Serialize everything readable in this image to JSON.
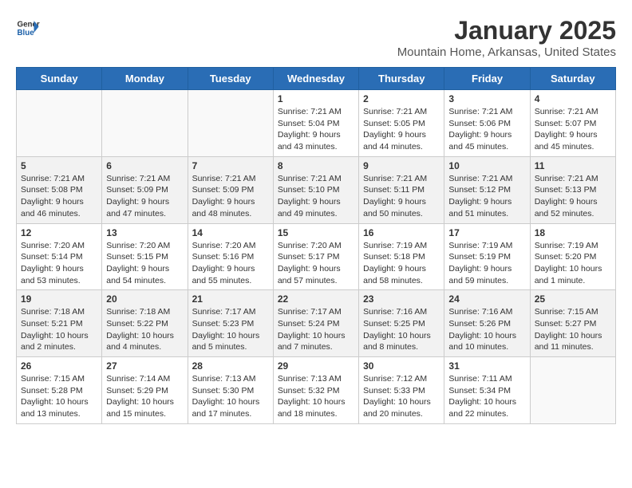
{
  "header": {
    "logo_general": "General",
    "logo_blue": "Blue",
    "title": "January 2025",
    "subtitle": "Mountain Home, Arkansas, United States"
  },
  "days_of_week": [
    "Sunday",
    "Monday",
    "Tuesday",
    "Wednesday",
    "Thursday",
    "Friday",
    "Saturday"
  ],
  "weeks": [
    {
      "bg": "white",
      "days": [
        {
          "date": "",
          "content": ""
        },
        {
          "date": "",
          "content": ""
        },
        {
          "date": "",
          "content": ""
        },
        {
          "date": "1",
          "content": "Sunrise: 7:21 AM\nSunset: 5:04 PM\nDaylight: 9 hours and 43 minutes."
        },
        {
          "date": "2",
          "content": "Sunrise: 7:21 AM\nSunset: 5:05 PM\nDaylight: 9 hours and 44 minutes."
        },
        {
          "date": "3",
          "content": "Sunrise: 7:21 AM\nSunset: 5:06 PM\nDaylight: 9 hours and 45 minutes."
        },
        {
          "date": "4",
          "content": "Sunrise: 7:21 AM\nSunset: 5:07 PM\nDaylight: 9 hours and 45 minutes."
        }
      ]
    },
    {
      "bg": "light",
      "days": [
        {
          "date": "5",
          "content": "Sunrise: 7:21 AM\nSunset: 5:08 PM\nDaylight: 9 hours and 46 minutes."
        },
        {
          "date": "6",
          "content": "Sunrise: 7:21 AM\nSunset: 5:09 PM\nDaylight: 9 hours and 47 minutes."
        },
        {
          "date": "7",
          "content": "Sunrise: 7:21 AM\nSunset: 5:09 PM\nDaylight: 9 hours and 48 minutes."
        },
        {
          "date": "8",
          "content": "Sunrise: 7:21 AM\nSunset: 5:10 PM\nDaylight: 9 hours and 49 minutes."
        },
        {
          "date": "9",
          "content": "Sunrise: 7:21 AM\nSunset: 5:11 PM\nDaylight: 9 hours and 50 minutes."
        },
        {
          "date": "10",
          "content": "Sunrise: 7:21 AM\nSunset: 5:12 PM\nDaylight: 9 hours and 51 minutes."
        },
        {
          "date": "11",
          "content": "Sunrise: 7:21 AM\nSunset: 5:13 PM\nDaylight: 9 hours and 52 minutes."
        }
      ]
    },
    {
      "bg": "white",
      "days": [
        {
          "date": "12",
          "content": "Sunrise: 7:20 AM\nSunset: 5:14 PM\nDaylight: 9 hours and 53 minutes."
        },
        {
          "date": "13",
          "content": "Sunrise: 7:20 AM\nSunset: 5:15 PM\nDaylight: 9 hours and 54 minutes."
        },
        {
          "date": "14",
          "content": "Sunrise: 7:20 AM\nSunset: 5:16 PM\nDaylight: 9 hours and 55 minutes."
        },
        {
          "date": "15",
          "content": "Sunrise: 7:20 AM\nSunset: 5:17 PM\nDaylight: 9 hours and 57 minutes."
        },
        {
          "date": "16",
          "content": "Sunrise: 7:19 AM\nSunset: 5:18 PM\nDaylight: 9 hours and 58 minutes."
        },
        {
          "date": "17",
          "content": "Sunrise: 7:19 AM\nSunset: 5:19 PM\nDaylight: 9 hours and 59 minutes."
        },
        {
          "date": "18",
          "content": "Sunrise: 7:19 AM\nSunset: 5:20 PM\nDaylight: 10 hours and 1 minute."
        }
      ]
    },
    {
      "bg": "light",
      "days": [
        {
          "date": "19",
          "content": "Sunrise: 7:18 AM\nSunset: 5:21 PM\nDaylight: 10 hours and 2 minutes."
        },
        {
          "date": "20",
          "content": "Sunrise: 7:18 AM\nSunset: 5:22 PM\nDaylight: 10 hours and 4 minutes."
        },
        {
          "date": "21",
          "content": "Sunrise: 7:17 AM\nSunset: 5:23 PM\nDaylight: 10 hours and 5 minutes."
        },
        {
          "date": "22",
          "content": "Sunrise: 7:17 AM\nSunset: 5:24 PM\nDaylight: 10 hours and 7 minutes."
        },
        {
          "date": "23",
          "content": "Sunrise: 7:16 AM\nSunset: 5:25 PM\nDaylight: 10 hours and 8 minutes."
        },
        {
          "date": "24",
          "content": "Sunrise: 7:16 AM\nSunset: 5:26 PM\nDaylight: 10 hours and 10 minutes."
        },
        {
          "date": "25",
          "content": "Sunrise: 7:15 AM\nSunset: 5:27 PM\nDaylight: 10 hours and 11 minutes."
        }
      ]
    },
    {
      "bg": "white",
      "days": [
        {
          "date": "26",
          "content": "Sunrise: 7:15 AM\nSunset: 5:28 PM\nDaylight: 10 hours and 13 minutes."
        },
        {
          "date": "27",
          "content": "Sunrise: 7:14 AM\nSunset: 5:29 PM\nDaylight: 10 hours and 15 minutes."
        },
        {
          "date": "28",
          "content": "Sunrise: 7:13 AM\nSunset: 5:30 PM\nDaylight: 10 hours and 17 minutes."
        },
        {
          "date": "29",
          "content": "Sunrise: 7:13 AM\nSunset: 5:32 PM\nDaylight: 10 hours and 18 minutes."
        },
        {
          "date": "30",
          "content": "Sunrise: 7:12 AM\nSunset: 5:33 PM\nDaylight: 10 hours and 20 minutes."
        },
        {
          "date": "31",
          "content": "Sunrise: 7:11 AM\nSunset: 5:34 PM\nDaylight: 10 hours and 22 minutes."
        },
        {
          "date": "",
          "content": ""
        }
      ]
    }
  ]
}
